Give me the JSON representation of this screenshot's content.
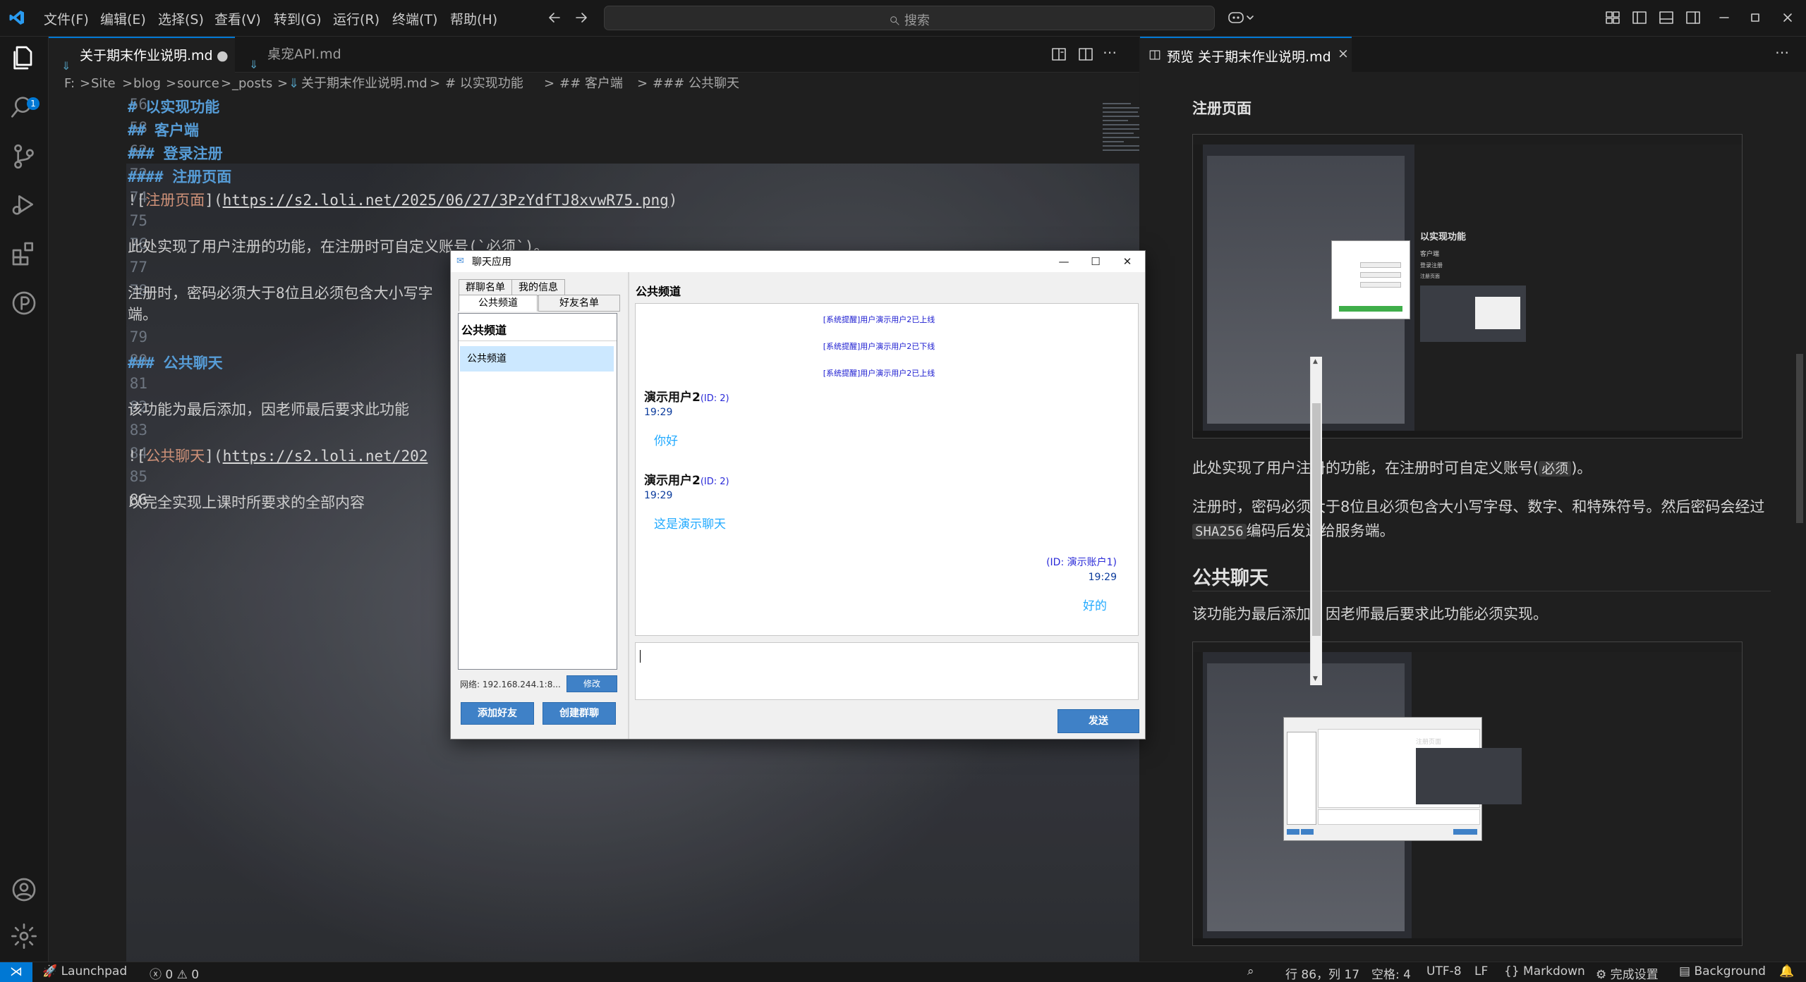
{
  "titlebar": {
    "menus": [
      "文件(F)",
      "编辑(E)",
      "选择(S)",
      "查看(V)",
      "转到(G)",
      "运行(R)",
      "终端(T)",
      "帮助(H)"
    ],
    "search_placeholder": "搜索"
  },
  "activity": {
    "explorer_badge": "1"
  },
  "editor": {
    "tabs": [
      {
        "label": "关于期末作业说明.md",
        "dirty": true
      },
      {
        "label": "桌宠API.md"
      }
    ],
    "breadcrumb": [
      "F:",
      "Site",
      "blog",
      "source",
      "_posts",
      "关于期末作业说明.md",
      "# 以实现功能",
      "## 客户端",
      "### 登录注册",
      "### 公共聊天"
    ],
    "lines": [
      {
        "num": "56",
        "text": "# 以实现功能",
        "kind": "heading"
      },
      {
        "num": "58",
        "text": "## 客户端",
        "kind": "heading"
      },
      {
        "num": "62",
        "text": "### 登录注册",
        "kind": "heading"
      },
      {
        "num": "72",
        "text": "#### 注册页面",
        "kind": "heading"
      },
      {
        "num": "74",
        "pre": "![",
        "linktext": "注册页面",
        "mid": "](",
        "url": "https://s2.loli.net/2025/06/27/3PzYdfTJ8xvwR75.png",
        "post": ")",
        "kind": "image"
      },
      {
        "num": "75",
        "text": ""
      },
      {
        "num": "76",
        "text": "此处实现了用户注册的功能，在注册时可自定义账号(`必须`)。"
      },
      {
        "num": "77",
        "text": ""
      },
      {
        "num": "78",
        "text": "注册时，密码必须大于8位且必须包含大小写字",
        "wrap": "端。"
      },
      {
        "num": "79",
        "text": ""
      },
      {
        "num": "80",
        "text": "### 公共聊天",
        "kind": "heading"
      },
      {
        "num": "81",
        "text": ""
      },
      {
        "num": "82",
        "text": "该功能为最后添加，因老师最后要求此功能"
      },
      {
        "num": "83",
        "text": ""
      },
      {
        "num": "84",
        "pre": "![",
        "linktext": "公共聊天",
        "mid": "](",
        "url": "https://s2.loli.net/202",
        "post": "",
        "kind": "image"
      },
      {
        "num": "85",
        "text": ""
      },
      {
        "num": "86",
        "text": "以完全实现上课时所要求的全部内容",
        "current": true
      }
    ]
  },
  "preview": {
    "tab_label": "预览 关于期末作业说明.md",
    "h_register": "注册页面",
    "p1_before": "此处实现了用户注册的功能，在注册时可自定义账号(",
    "p1_code": "必须",
    "p1_after": ")。",
    "p2_line1": "注册时，密码必须大于8位且必须包含大小写字母、数字、和特殊符号。然后密码会经过",
    "p2_code": "SHA256",
    "p2_after": "编码后发送给服务端。",
    "h_public": "公共聊天",
    "p3": "该功能为最后添加，因老师最后要求此功能必须实现。",
    "shot_small_title": "以实现功能",
    "shot_small_sub1": "客户端",
    "shot_small_sub2": "登录注册",
    "shot_small_sub3": "注册页面",
    "shot_small_title2": "注册页面"
  },
  "chat": {
    "title": "聊天应用",
    "tabs_top": [
      "群聊名单",
      "我的信息"
    ],
    "tabs_bottom": [
      "公共频道",
      "好友名单"
    ],
    "list_title": "公共频道",
    "list_items": [
      "公共频道"
    ],
    "network_label": "网络: 192.168.244.1:8...",
    "modify_btn": "修改",
    "add_friend_btn": "添加好友",
    "create_group_btn": "创建群聊",
    "channel_header": "公共频道",
    "system_msgs": [
      "[系统提醒]用户演示用户2已上线",
      "[系统提醒]用户演示用户2已下线",
      "[系统提醒]用户演示用户2已上线"
    ],
    "messages": [
      {
        "sender": "演示用户2",
        "id": "(ID: 2)",
        "time": "19:29",
        "text": "你好"
      },
      {
        "sender": "演示用户2",
        "id": "(ID: 2)",
        "time": "19:29",
        "text": "这是演示聊天"
      }
    ],
    "self_message": {
      "id": "(ID: 演示账户1)",
      "time": "19:29",
      "text": "好的"
    },
    "send_btn": "发送"
  },
  "statusbar": {
    "launchpad": "Launchpad",
    "problems": "0",
    "warnings": "0",
    "position": "行 86，列 17",
    "spaces": "空格: 4",
    "encoding": "UTF-8",
    "eol": "LF",
    "language": "Markdown",
    "setup": "完成设置",
    "background": "Background"
  },
  "colors": {
    "accent": "#0078d4",
    "heading": "#569cd6",
    "link": "#ce9178",
    "chat_button": "#3f81c7"
  }
}
